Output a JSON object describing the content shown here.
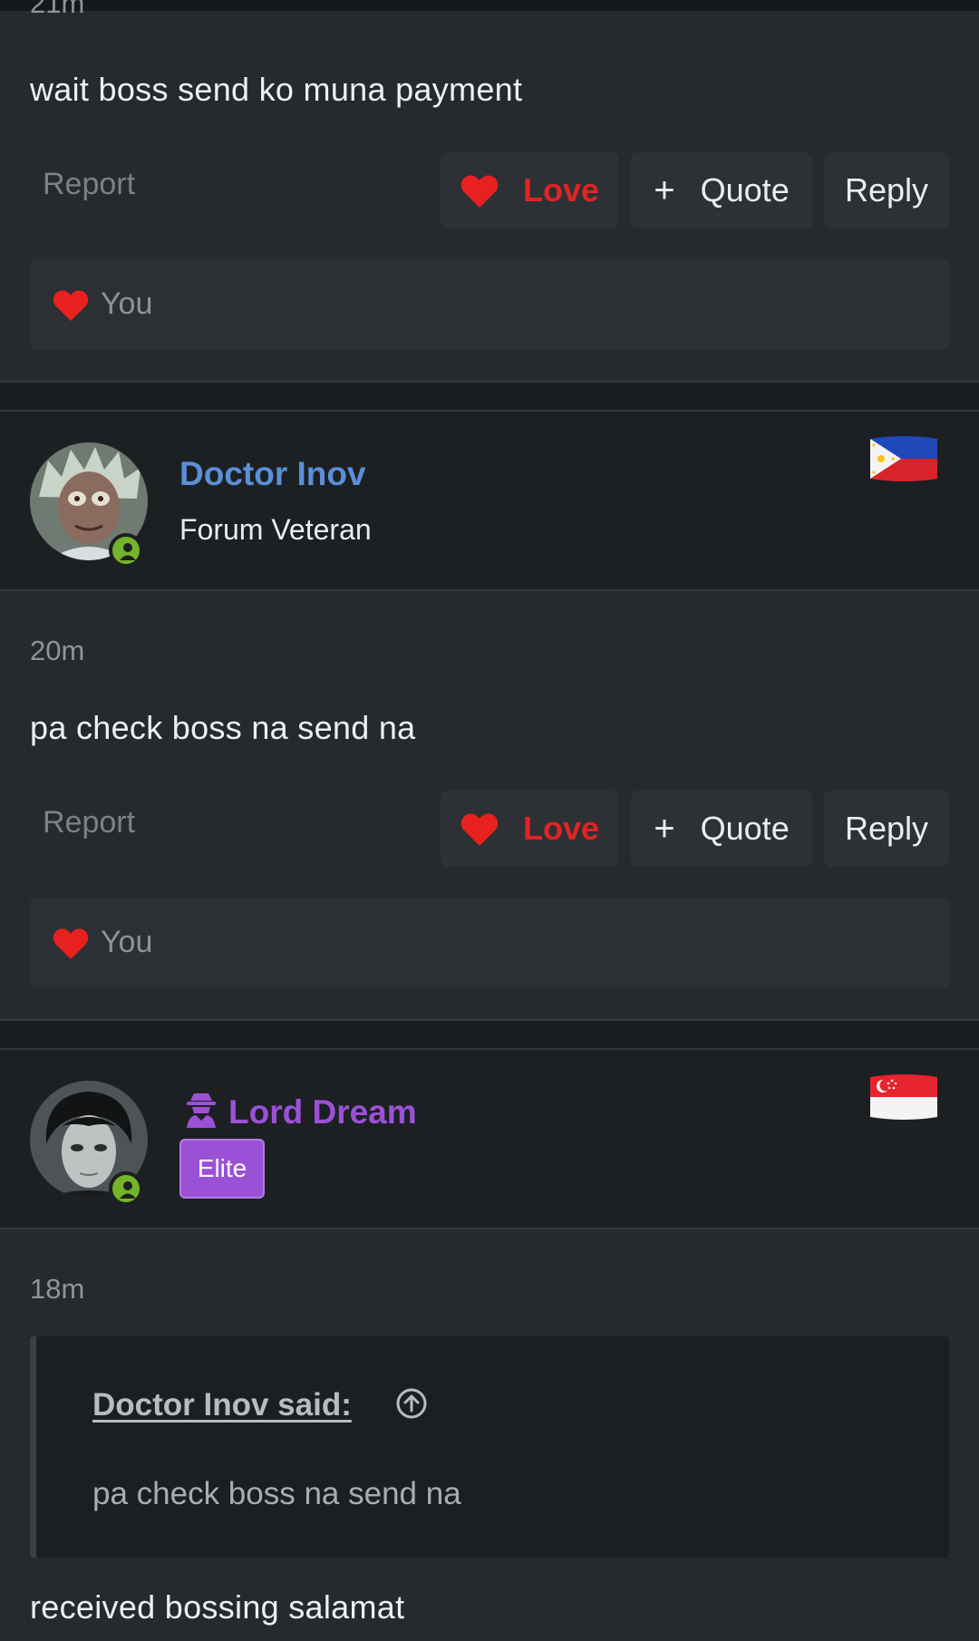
{
  "colors": {
    "page_bg": "#23272b",
    "header_bg": "#1d2023",
    "love_red": "#e02424",
    "username_blue": "#5b8fd6",
    "username_purple": "#9b51d6",
    "online_green": "#74b32a",
    "elite_badge": "#9b51d6"
  },
  "post1": {
    "timestamp": "21m",
    "message": "wait boss send ko muna payment",
    "actions": {
      "report": "Report",
      "love": "Love",
      "quote": "Quote",
      "reply": "Reply"
    },
    "reaction_users": "You"
  },
  "post2": {
    "username": "Doctor Inov",
    "user_title": "Forum Veteran",
    "flag": "philippines-flag-icon",
    "timestamp": "20m",
    "message": "pa check boss na send na",
    "actions": {
      "report": "Report",
      "love": "Love",
      "quote": "Quote",
      "reply": "Reply"
    },
    "reaction_users": "You"
  },
  "post3": {
    "username": "Lord Dream",
    "user_badge": "Elite",
    "flag": "singapore-flag-icon",
    "timestamp": "18m",
    "quote": {
      "author": "Doctor Inov said:",
      "text": "pa check boss na send na"
    },
    "message": "received bossing salamat"
  }
}
